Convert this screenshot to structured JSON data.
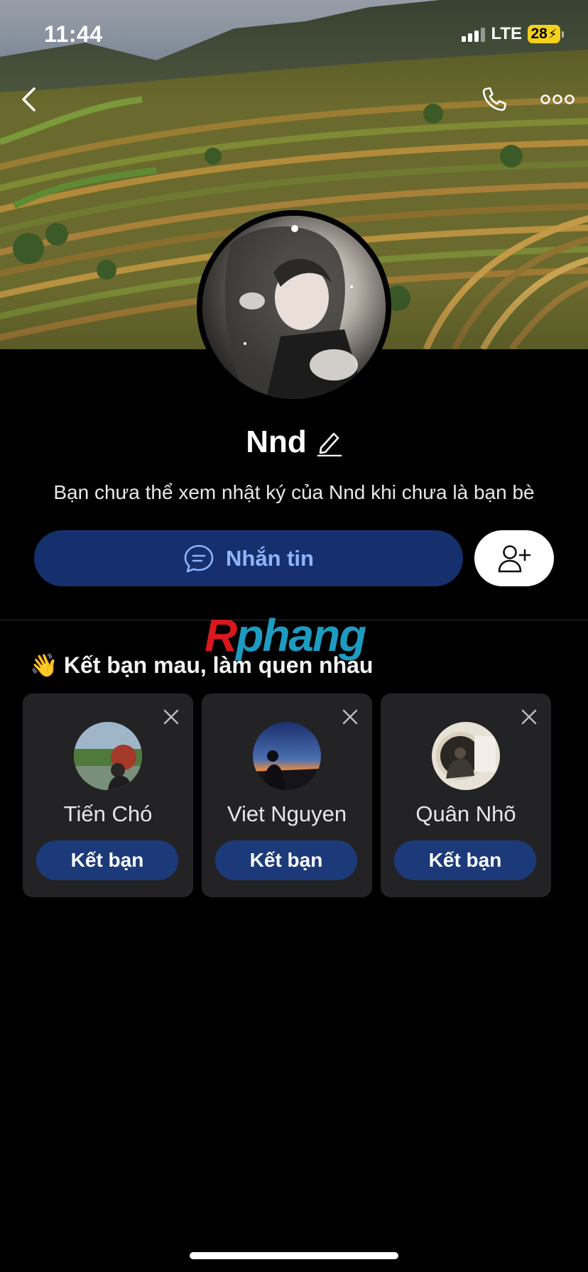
{
  "status_bar": {
    "time": "11:44",
    "network": "LTE",
    "battery": "28"
  },
  "header": {
    "back_icon": "chevron-left-icon",
    "call_icon": "phone-icon",
    "more_icon": "ellipsis-icon"
  },
  "profile": {
    "name": "Nnd",
    "edit_icon": "pencil-icon",
    "diary_notice": "Bạn chưa thể xem nhật ký của Nnd khi chưa là bạn bè"
  },
  "actions": {
    "message_label": "Nhắn tin",
    "message_icon": "chat-bubble-icon",
    "add_friend_icon": "add-user-icon"
  },
  "watermark": {
    "first": "R",
    "rest": "phang"
  },
  "suggestions": {
    "emoji": "👋",
    "title": "Kết bạn mau, làm quen nhau",
    "items": [
      {
        "name": "Tiến Chó",
        "button": "Kết bạn"
      },
      {
        "name": "Viet Nguyen",
        "button": "Kết bạn"
      },
      {
        "name": "Quân Nhõ",
        "button": "Kết bạn"
      }
    ]
  },
  "colors": {
    "message_button_bg": "#16306d",
    "message_button_text": "#8eb4ff",
    "card_bg": "#232325",
    "card_button_bg": "#1c3a7a",
    "battery": "#f4d21c"
  }
}
